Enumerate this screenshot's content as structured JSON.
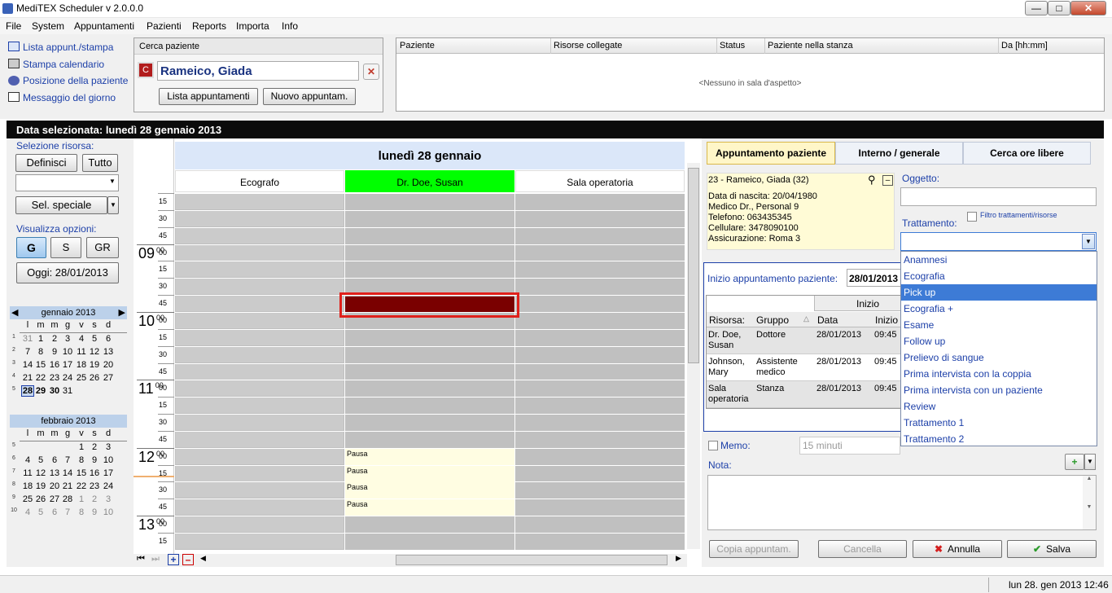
{
  "app": {
    "title": "MediTEX  Scheduler v 2.0.0.0"
  },
  "menu": [
    "File",
    "System",
    "Appuntamenti",
    "Pazienti",
    "Reports",
    "Importa",
    "Info"
  ],
  "quicklinks": [
    "Lista appunt./stampa",
    "Stampa calendario",
    "Posizione della paziente",
    "Messaggio del giorno"
  ],
  "search": {
    "label": "Cerca paziente",
    "patient": "Rameico, Giada",
    "btn_list": "Lista appuntamenti",
    "btn_new": "Nuovo appuntam."
  },
  "waiting": {
    "headers": [
      "Paziente",
      "Risorse collegate",
      "Status",
      "Paziente nella stanza",
      "Da [hh:mm]"
    ],
    "empty": "<Nessuno in sala d'aspetto>"
  },
  "selected_date": "Data selezionata: lunedì 28 gennaio 2013",
  "left": {
    "resource_label": "Selezione risorsa:",
    "btn_define": "Definisci",
    "btn_all": "Tutto",
    "btn_special": "Sel. speciale",
    "view_label": "Visualizza opzioni:",
    "view_g": "G",
    "view_s": "S",
    "view_gr": "GR",
    "today": "Oggi: 28/01/2013"
  },
  "cal_jan": {
    "title": "gennaio 2013",
    "dow": [
      "l",
      "m",
      "m",
      "g",
      "v",
      "s",
      "d"
    ],
    "weeks": [
      {
        "wk": "1",
        "days": [
          "31",
          "1",
          "2",
          "3",
          "4",
          "5",
          "6"
        ]
      },
      {
        "wk": "2",
        "days": [
          "7",
          "8",
          "9",
          "10",
          "11",
          "12",
          "13"
        ]
      },
      {
        "wk": "3",
        "days": [
          "14",
          "15",
          "16",
          "17",
          "18",
          "19",
          "20"
        ]
      },
      {
        "wk": "4",
        "days": [
          "21",
          "22",
          "23",
          "24",
          "25",
          "26",
          "27"
        ]
      },
      {
        "wk": "5",
        "days": [
          "28",
          "29",
          "30",
          "31",
          "",
          "",
          ""
        ]
      }
    ]
  },
  "cal_feb": {
    "title": "febbraio 2013",
    "dow": [
      "l",
      "m",
      "m",
      "g",
      "v",
      "s",
      "d"
    ],
    "weeks": [
      {
        "wk": "5",
        "days": [
          "",
          "",
          "",
          "",
          "1",
          "2",
          "3"
        ]
      },
      {
        "wk": "6",
        "days": [
          "4",
          "5",
          "6",
          "7",
          "8",
          "9",
          "10"
        ]
      },
      {
        "wk": "7",
        "days": [
          "11",
          "12",
          "13",
          "14",
          "15",
          "16",
          "17"
        ]
      },
      {
        "wk": "8",
        "days": [
          "18",
          "19",
          "20",
          "21",
          "22",
          "23",
          "24"
        ]
      },
      {
        "wk": "9",
        "days": [
          "25",
          "26",
          "27",
          "28",
          "1",
          "2",
          "3"
        ]
      },
      {
        "wk": "10",
        "days": [
          "4",
          "5",
          "6",
          "7",
          "8",
          "9",
          "10"
        ]
      }
    ]
  },
  "schedule": {
    "day_title": "lunedì 28 gennaio",
    "columns": [
      "Ecografo",
      "Dr. Doe, Susan",
      "Sala operatoria"
    ],
    "pause": "Pausa",
    "hours": [
      "09",
      "10",
      "11",
      "12",
      "13"
    ],
    "slot_labels": [
      "15",
      "30",
      "45",
      "00",
      "15",
      "30",
      "45",
      "00",
      "15",
      "30",
      "45",
      "00",
      "15",
      "30",
      "45",
      "00",
      "15",
      "30",
      "45",
      "00",
      "15",
      "30",
      "45",
      "00",
      "15"
    ],
    "minute_super": "00"
  },
  "right": {
    "tabs": [
      "Appuntamento paziente",
      "Interno / generale",
      "Cerca ore libere"
    ],
    "patient_header": "23 - Rameico, Giada (32)",
    "patient_lines": [
      "Data di nascita: 20/04/1980",
      "Medico Dr., Personal 9",
      "Telefono:  063435345",
      "Cellulare: 3478090100",
      "Assicurazione: Roma 3"
    ],
    "oggetto_label": "Oggetto:",
    "trattamento_label": "Trattamento:",
    "filter_label": "Filtro trattamenti/risorse",
    "start_label": "Inizio appuntamento paziente:",
    "start_value": "28/01/2013",
    "grid_group": "Inizio",
    "grid_headers": [
      "Risorsa:",
      "Gruppo",
      "Data",
      "Inizio"
    ],
    "grid_rows": [
      {
        "res": "Dr. Doe, Susan",
        "group": "Dottore",
        "date": "28/01/2013",
        "time": "09:45"
      },
      {
        "res": "Johnson, Mary",
        "group": "Assistente medico",
        "date": "28/01/2013",
        "time": "09:45"
      },
      {
        "res": "Sala operatoria",
        "group": "Stanza",
        "date": "28/01/2013",
        "time": "09:45"
      }
    ],
    "dropdown": [
      "Anamnesi",
      "Ecografia",
      "Pick up",
      "Ecografia +",
      "Esame",
      "Follow up",
      "Prelievo di sangue",
      "Prima intervista con la coppia",
      "Prima intervista con un paziente",
      "Review",
      "Trattamento 1",
      "Trattamento 2"
    ],
    "memo_label": "Memo:",
    "memo_value": "15 minuti",
    "nota_label": "Nota:",
    "btn_copy": "Copia appuntam.",
    "btn_cancel": "Cancella",
    "btn_annulla": "Annulla",
    "btn_salva": "Salva"
  },
  "status": {
    "datetime": "lun 28. gen 2013 12:46"
  },
  "colors": {
    "selected_block": "#7a0000",
    "highlight": "#e0201b",
    "doctor_header": "#00ff00",
    "pause_bg": "#fffde2",
    "link": "#1c3fa8"
  }
}
